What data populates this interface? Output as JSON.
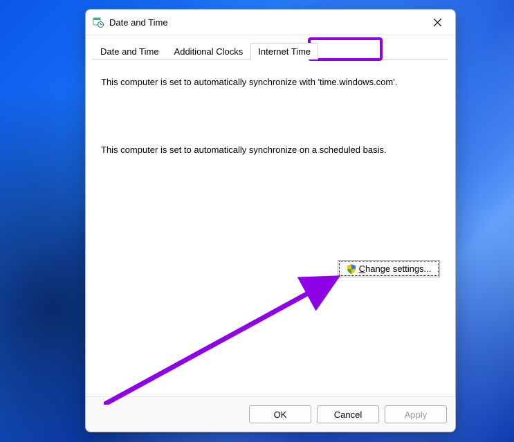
{
  "window": {
    "title": "Date and Time"
  },
  "tabs": {
    "items": [
      {
        "label": "Date and Time"
      },
      {
        "label": "Additional Clocks"
      },
      {
        "label": "Internet Time"
      }
    ],
    "active_index": 2
  },
  "body": {
    "sync_server_line": "This computer is set to automatically synchronize with 'time.windows.com'.",
    "sync_schedule_line": "This computer is set to automatically synchronize on a scheduled basis."
  },
  "buttons": {
    "change_settings": "Change settings...",
    "ok": "OK",
    "cancel": "Cancel",
    "apply": "Apply"
  },
  "annotation": {
    "highlight_color": "#8e00e6"
  }
}
